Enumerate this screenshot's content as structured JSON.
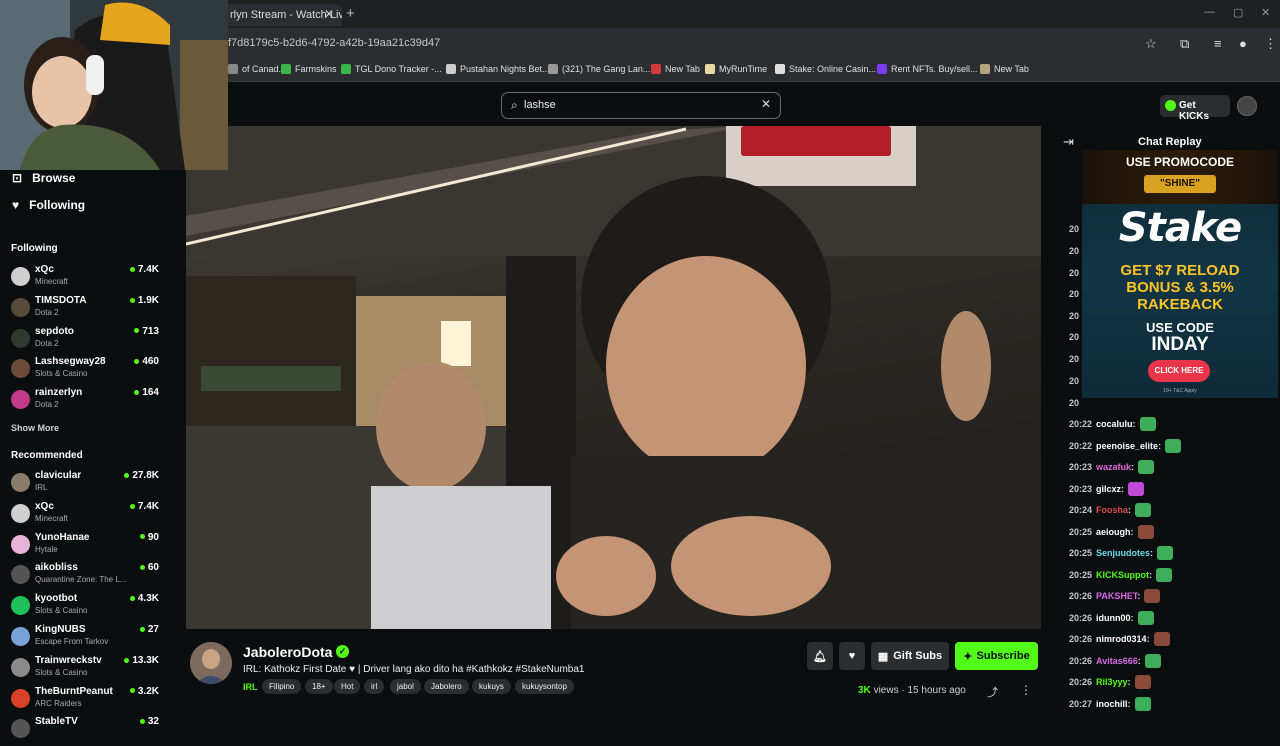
{
  "browser": {
    "tab_title": "rlyn Stream - Watch Live",
    "tab_close": "✕",
    "new_tab": "+",
    "url": "f7d8179c5-b2d6-4792-a42b-19aa21c39d47",
    "bookmarks": [
      {
        "label": "of Canad...",
        "color": "#888888"
      },
      {
        "label": "Farmskins",
        "color": "#3ab54a"
      },
      {
        "label": "TGL Dono Tracker -...",
        "color": "#3ab54a"
      },
      {
        "label": "Pustahan Nights Bet...",
        "color": "#cccccc"
      },
      {
        "label": "(321) The Gang Lan...",
        "color": "#999999"
      },
      {
        "label": "New Tab",
        "color": "#d33b3b"
      },
      {
        "label": "MyRunTime",
        "color": "#e9d6a4"
      },
      {
        "label": "Stake: Online Casin...",
        "color": "#dddddd"
      },
      {
        "label": "Rent NFTs. Buy/sell...",
        "color": "#7a3cf0"
      },
      {
        "label": "New Tab",
        "color": "#b5a27a"
      }
    ]
  },
  "header": {
    "search_value": "lashse",
    "get_kicks": "Get KICKs"
  },
  "sidebar": {
    "nav": [
      {
        "label": "Browse",
        "icon": "browse-icon"
      },
      {
        "label": "Following",
        "icon": "heart-icon"
      }
    ],
    "following_heading": "Following",
    "following": [
      {
        "name": "xQc",
        "category": "Minecraft",
        "viewers": "7.4K",
        "color": "#cfcfcf"
      },
      {
        "name": "TIMSDOTA",
        "category": "Dota 2",
        "viewers": "1.9K",
        "color": "#5a4a3a"
      },
      {
        "name": "sepdoto",
        "category": "Dota 2",
        "viewers": "713",
        "color": "#2f3a2f"
      },
      {
        "name": "Lashsegway28",
        "category": "Slots & Casino",
        "viewers": "460",
        "color": "#6b4a3a"
      },
      {
        "name": "rainzerlyn",
        "category": "Dota 2",
        "viewers": "164",
        "color": "#c23a8a"
      }
    ],
    "show_more": "Show More",
    "recommended_heading": "Recommended",
    "recommended": [
      {
        "name": "clavicular",
        "category": "IRL",
        "viewers": "27.8K",
        "color": "#8a7a6a"
      },
      {
        "name": "xQc",
        "category": "Minecraft",
        "viewers": "7.4K",
        "color": "#cfcfcf"
      },
      {
        "name": "YunoHanae",
        "category": "Hytale",
        "viewers": "90",
        "color": "#e8b3d8"
      },
      {
        "name": "aikobliss",
        "category": "Quarantine Zone: The L...",
        "viewers": "60",
        "color": "#555555"
      },
      {
        "name": "kyootbot",
        "category": "Slots & Casino",
        "viewers": "4.3K",
        "color": "#1fc25a"
      },
      {
        "name": "KingNUBS",
        "category": "Escape From Tarkov",
        "viewers": "27",
        "color": "#7aa2d8"
      },
      {
        "name": "Trainwreckstv",
        "category": "Slots & Casino",
        "viewers": "13.3K",
        "color": "#8a8a8a"
      },
      {
        "name": "TheBurntPeanut",
        "category": "ARC Raiders",
        "viewers": "3.2K",
        "color": "#d8422a"
      },
      {
        "name": "StableTV",
        "category": "",
        "viewers": "32",
        "color": "#555555"
      }
    ]
  },
  "channel": {
    "name": "JaboleroDota",
    "verified_mark": "✓",
    "title": "IRL: Kathokz First Date ♥ | Driver lang ako dito ha #Kathkokz #StakeNumba1",
    "category": "IRL",
    "tags": [
      "Filipino",
      "18+",
      "Hot",
      "irl",
      "jabol",
      "Jabolero",
      "kukuys",
      "kukuysontop"
    ],
    "gift_subs": "Gift Subs",
    "subscribe": "Subscribe",
    "views_count": "3K",
    "views_label": "views",
    "age": "15 hours ago"
  },
  "chat": {
    "title": "Chat Replay",
    "hidden_timestamps": [
      "20",
      "20",
      "20",
      "20",
      "20",
      "20",
      "20",
      "20",
      "20"
    ],
    "messages": [
      {
        "time": "20:22",
        "user": "cocalulu",
        "color": "#ffffff",
        "emote": "#3fae5a"
      },
      {
        "time": "20:22",
        "user": "peenoise_elite",
        "color": "#ffffff",
        "emote": "#3fae5a"
      },
      {
        "time": "20:23",
        "user": "wazafuk",
        "color": "#e06ad8",
        "emote": "#3fae5a"
      },
      {
        "time": "20:23",
        "user": "gilcxz",
        "color": "#ffffff",
        "emote": "#c04ad8"
      },
      {
        "time": "20:24",
        "user": "Foosha",
        "color": "#e04a4a",
        "emote": "#3fae5a"
      },
      {
        "time": "20:25",
        "user": "aeiough",
        "color": "#ffffff",
        "emote": "#8a4a3a"
      },
      {
        "time": "20:25",
        "user": "Senjuudotes",
        "color": "#6ad8e8",
        "emote": "#3fae5a"
      },
      {
        "time": "20:25",
        "user": "KICKSuppot",
        "color": "#53fc18",
        "emote": "#3fae5a"
      },
      {
        "time": "20:26",
        "user": "PAKSHET",
        "color": "#d86ae8",
        "emote": "#8a4a3a"
      },
      {
        "time": "20:26",
        "user": "idunn00",
        "color": "#ffffff",
        "emote": "#3fae5a"
      },
      {
        "time": "20:26",
        "user": "nimrod0314",
        "color": "#ffffff",
        "emote": "#8a4a3a"
      },
      {
        "time": "20:26",
        "user": "Avitas666",
        "color": "#d86ae8",
        "emote": "#3fae5a"
      },
      {
        "time": "20:26",
        "user": "Ril3yyy",
        "color": "#53fc18",
        "emote": "#8a4a3a"
      },
      {
        "time": "20:27",
        "user": "inochill",
        "color": "#ffffff",
        "emote": "#3fae5a"
      }
    ]
  },
  "ad": {
    "promo": "USE PROMOCODE",
    "shine": "\"SHINE\"",
    "logo": "Stake",
    "line1": "GET $7 RELOAD",
    "line2": "BONUS & 3.5%",
    "line3": "RAKEBACK",
    "use_code": "USE CODE",
    "code": "INDAY",
    "cta": "CLICK HERE",
    "tc": "18+ T&C Apply"
  }
}
